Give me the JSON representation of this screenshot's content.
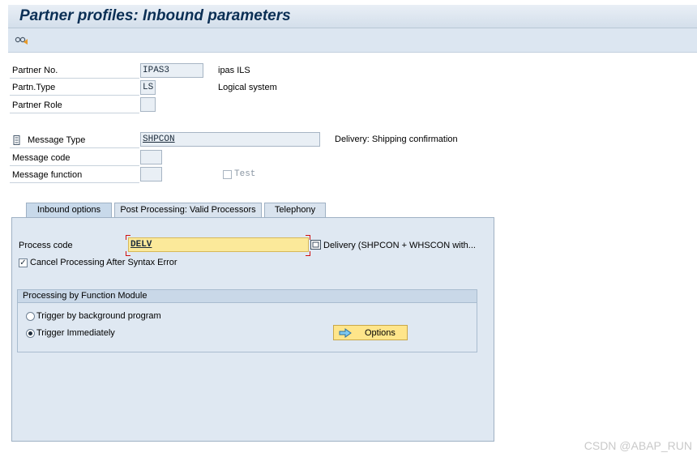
{
  "window": {
    "title": "Partner profiles: Inbound parameters"
  },
  "toolbar": {
    "execute_icon": "execute-glasses-icon"
  },
  "partner": {
    "partner_no": {
      "label": "Partner No.",
      "value": "IPAS3",
      "description": "ipas ILS"
    },
    "partner_type": {
      "label": "Partn.Type",
      "value": "LS",
      "description": "Logical system"
    },
    "partner_role": {
      "label": "Partner Role",
      "value": ""
    }
  },
  "message": {
    "message_type": {
      "label": "Message Type",
      "value": "SHPCON",
      "description": "Delivery: Shipping confirmation",
      "icon": "message-type-icon"
    },
    "message_code": {
      "label": "Message code",
      "value": ""
    },
    "message_function": {
      "label": "Message function",
      "value": ""
    },
    "test": {
      "label": "Test",
      "checked": false
    }
  },
  "tabs": [
    {
      "label": "Inbound options",
      "active": true
    },
    {
      "label": "Post Processing: Valid Processors",
      "active": false
    },
    {
      "label": "Telephony",
      "active": false
    }
  ],
  "inbound_options": {
    "process_code": {
      "label": "Process code",
      "value": "DELV",
      "description": "Delivery (SHPCON + WHSCON with..."
    },
    "cancel_processing": {
      "label": "Cancel Processing After Syntax Error",
      "checked": true
    },
    "group": {
      "title": "Processing by Function Module",
      "trigger_background": {
        "label": "Trigger by background program",
        "selected": false
      },
      "trigger_immediately": {
        "label": "Trigger Immediately",
        "selected": true
      },
      "options_button": {
        "label": "Options",
        "icon": "arrow-right-icon"
      }
    }
  },
  "watermark": "CSDN @ABAP_RUN",
  "colors": {
    "title": "#0b2f55",
    "panel": "#dfe8f2",
    "highlight_field": "#fbe99a",
    "button": "#ffe58a"
  }
}
